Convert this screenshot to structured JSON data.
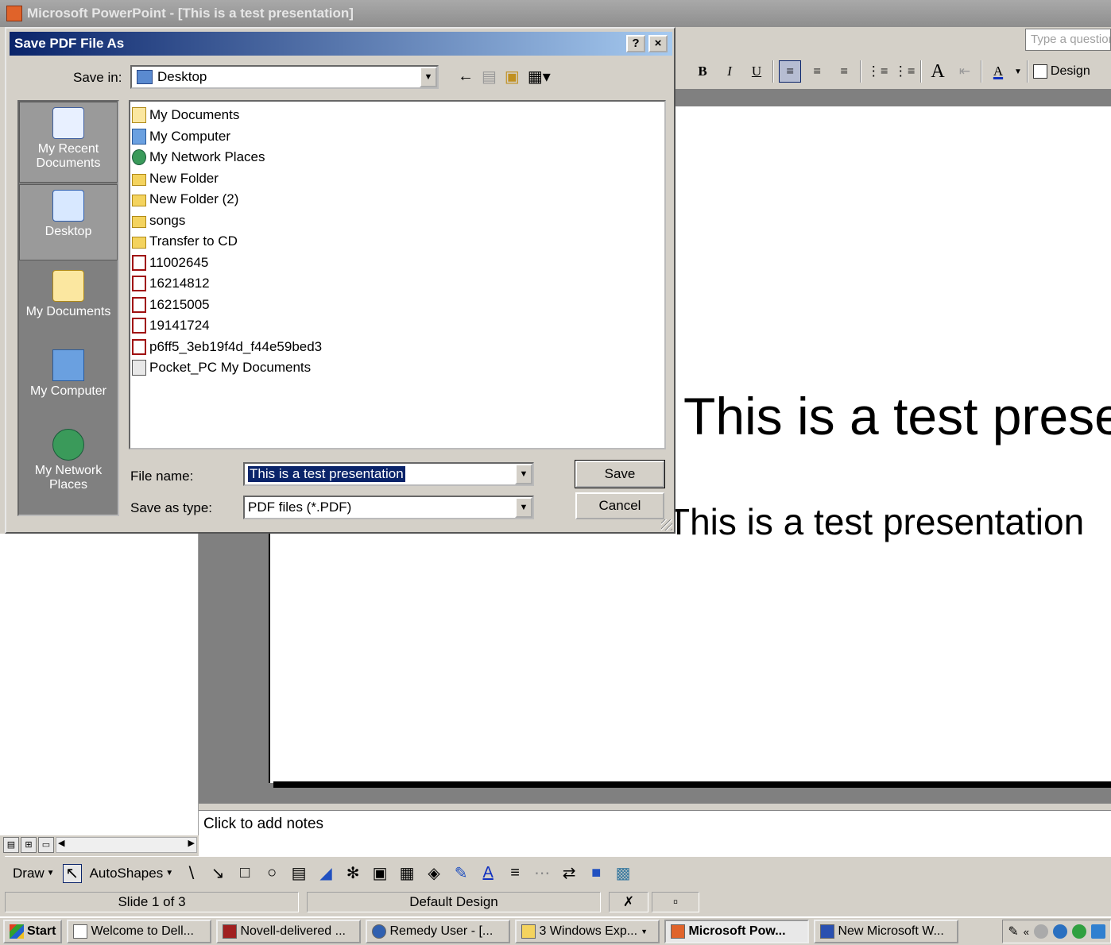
{
  "app": {
    "title": "Microsoft PowerPoint - [This is a test presentation]",
    "question_placeholder": "Type a question",
    "design_label": "Design"
  },
  "formatting_toolbar": {
    "bold": "B",
    "italic": "I",
    "underline": "U",
    "font_size_label": "A",
    "font_color_label": "A"
  },
  "slide": {
    "title_text": "This is a test presentation",
    "subtitle_text": "This is a test presentation"
  },
  "notes_placeholder": "Click to add notes",
  "dialog": {
    "title": "Save PDF File As",
    "help_label": "?",
    "close_label": "×",
    "save_in_label": "Save in:",
    "save_in_value": "Desktop",
    "places": [
      {
        "label": "My Recent Documents",
        "icon": "recent-documents-icon"
      },
      {
        "label": "Desktop",
        "icon": "desktop-icon"
      },
      {
        "label": "My Documents",
        "icon": "my-documents-icon"
      },
      {
        "label": "My Computer",
        "icon": "my-computer-icon"
      },
      {
        "label": "My Network Places",
        "icon": "network-places-icon"
      }
    ],
    "files": [
      {
        "name": "My Documents",
        "type": "mydocs"
      },
      {
        "name": "My Computer",
        "type": "comp"
      },
      {
        "name": "My Network Places",
        "type": "net"
      },
      {
        "name": "New Folder",
        "type": "folder"
      },
      {
        "name": "New Folder (2)",
        "type": "folder"
      },
      {
        "name": "songs",
        "type": "folder"
      },
      {
        "name": "Transfer to CD",
        "type": "folder"
      },
      {
        "name": "11002645",
        "type": "pdf"
      },
      {
        "name": "16214812",
        "type": "pdf"
      },
      {
        "name": "16215005",
        "type": "pdf"
      },
      {
        "name": "19141724",
        "type": "pdf"
      },
      {
        "name": "p6ff5_3eb19f4d_f44e59bed3",
        "type": "pdf"
      },
      {
        "name": "Pocket_PC My Documents",
        "type": "brief"
      }
    ],
    "file_name_label": "File name:",
    "file_name_value": "This is a test presentation",
    "save_as_type_label": "Save as type:",
    "save_as_type_value": "PDF files (*.PDF)",
    "save_button": "Save",
    "cancel_button": "Cancel"
  },
  "draw_toolbar": {
    "draw_label": "Draw",
    "autoshapes_label": "AutoShapes"
  },
  "status_bar": {
    "slide_info": "Slide 1 of 3",
    "design_name": "Default Design"
  },
  "taskbar": {
    "start_label": "Start",
    "tasks": [
      "Welcome to Dell...",
      "Novell-delivered ...",
      "Remedy User - [...",
      "3 Windows Exp...",
      "Microsoft Pow...",
      "New Microsoft W..."
    ],
    "active_index": 4
  },
  "colors": {
    "dialog_title_start": "#0a246a",
    "dialog_title_end": "#a6caf0",
    "selection": "#0a246a"
  }
}
